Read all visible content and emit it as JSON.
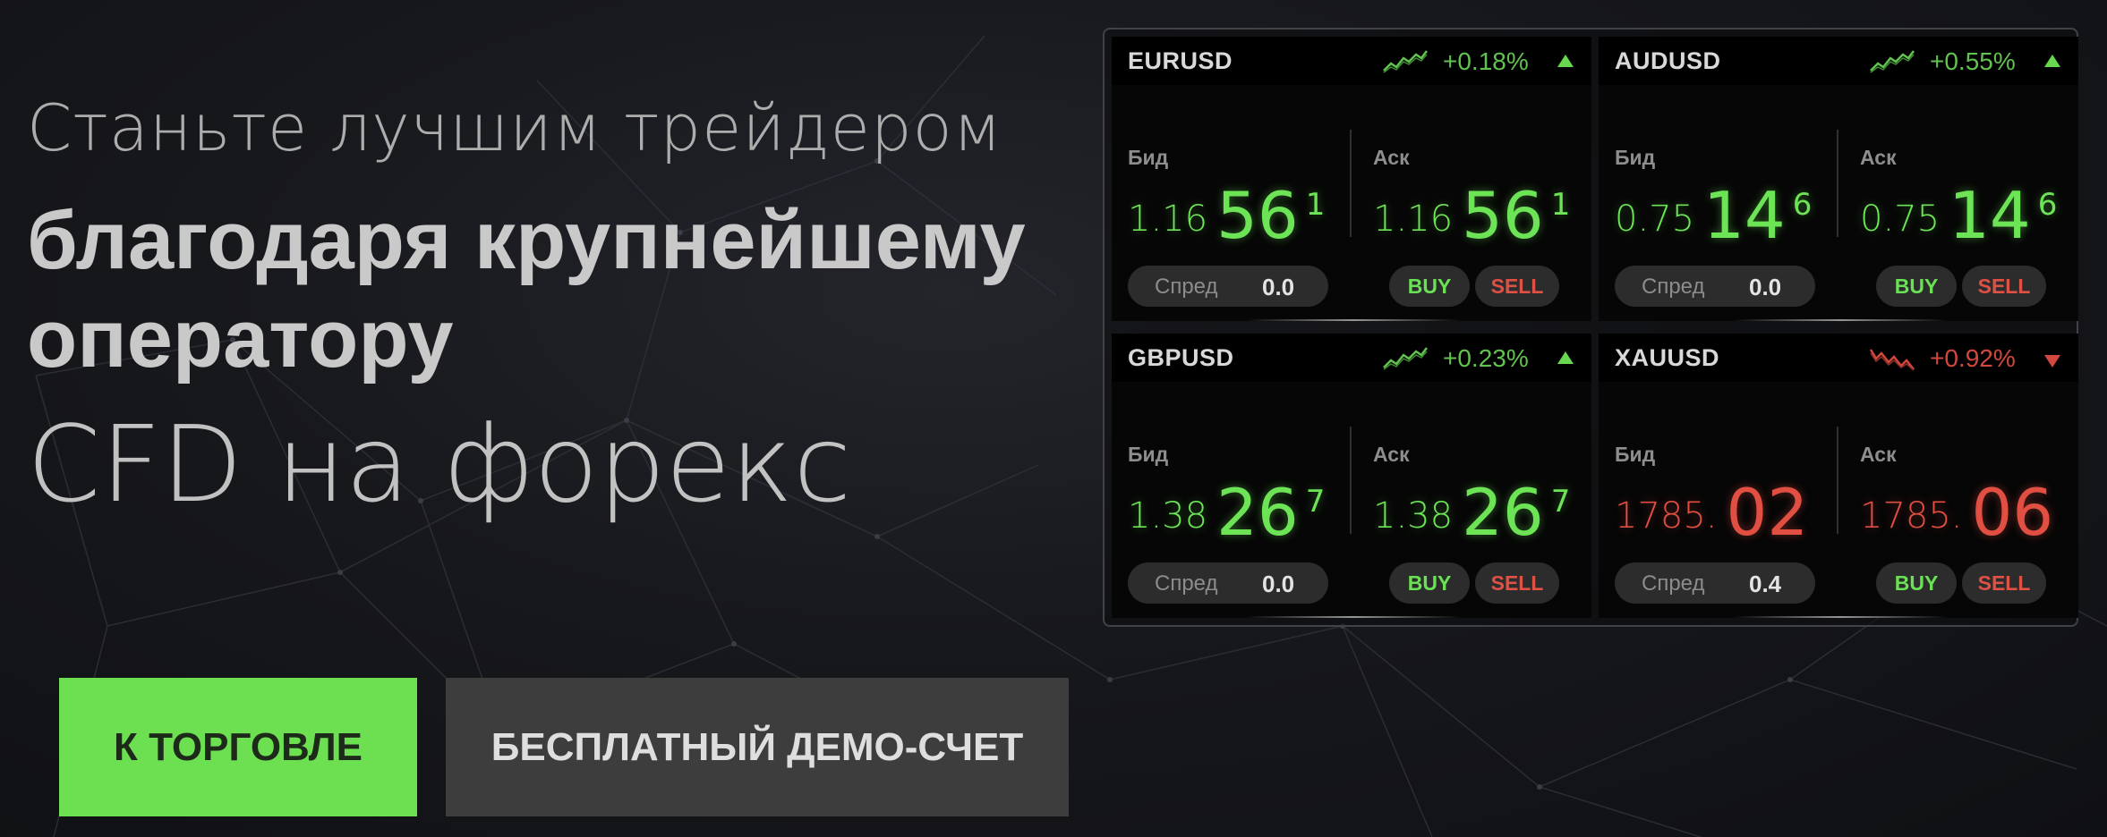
{
  "hero": {
    "line1": "Станьте лучшим трейдером",
    "line2a": "благодаря крупнейшему",
    "line2b": "оператору",
    "line3": "CFD на форекс"
  },
  "buttons": {
    "trade": "К ТОРГОВЛЕ",
    "demo": "БЕСПЛАТНЫЙ ДЕМО-СЧЕТ"
  },
  "colors": {
    "up": "#6ce456",
    "down": "#e14e42",
    "trade_button": "#6de052",
    "demo_button": "#3d3d3d"
  },
  "quotes": [
    {
      "symbol": "EURUSD",
      "change": "+0.18%",
      "direction": "up",
      "trend_icon": "trend-up-icon",
      "bid_label": "Бид",
      "ask_label": "Аск",
      "bid": {
        "prefix": "1.16",
        "main": "56",
        "pip": "1"
      },
      "ask": {
        "prefix": "1.16",
        "main": "56",
        "pip": "1"
      },
      "spread_label": "Спред",
      "spread": "0.0",
      "buy": "BUY",
      "sell": "SELL"
    },
    {
      "symbol": "AUDUSD",
      "change": "+0.55%",
      "direction": "up",
      "trend_icon": "trend-up-icon",
      "bid_label": "Бид",
      "ask_label": "Аск",
      "bid": {
        "prefix": "0.75",
        "main": "14",
        "pip": "6"
      },
      "ask": {
        "prefix": "0.75",
        "main": "14",
        "pip": "6"
      },
      "spread_label": "Спред",
      "spread": "0.0",
      "buy": "BUY",
      "sell": "SELL"
    },
    {
      "symbol": "GBPUSD",
      "change": "+0.23%",
      "direction": "up",
      "trend_icon": "trend-up-icon",
      "bid_label": "Бид",
      "ask_label": "Аск",
      "bid": {
        "prefix": "1.38",
        "main": "26",
        "pip": "7"
      },
      "ask": {
        "prefix": "1.38",
        "main": "26",
        "pip": "7"
      },
      "spread_label": "Спред",
      "spread": "0.0",
      "buy": "BUY",
      "sell": "SELL"
    },
    {
      "symbol": "XAUUSD",
      "change": "+0.92%",
      "direction": "down",
      "trend_icon": "trend-down-icon",
      "bid_label": "Бид",
      "ask_label": "Аск",
      "bid": {
        "prefix": "1785.",
        "main": "02",
        "pip": ""
      },
      "ask": {
        "prefix": "1785.",
        "main": "06",
        "pip": ""
      },
      "spread_label": "Спред",
      "spread": "0.4",
      "buy": "BUY",
      "sell": "SELL"
    }
  ]
}
